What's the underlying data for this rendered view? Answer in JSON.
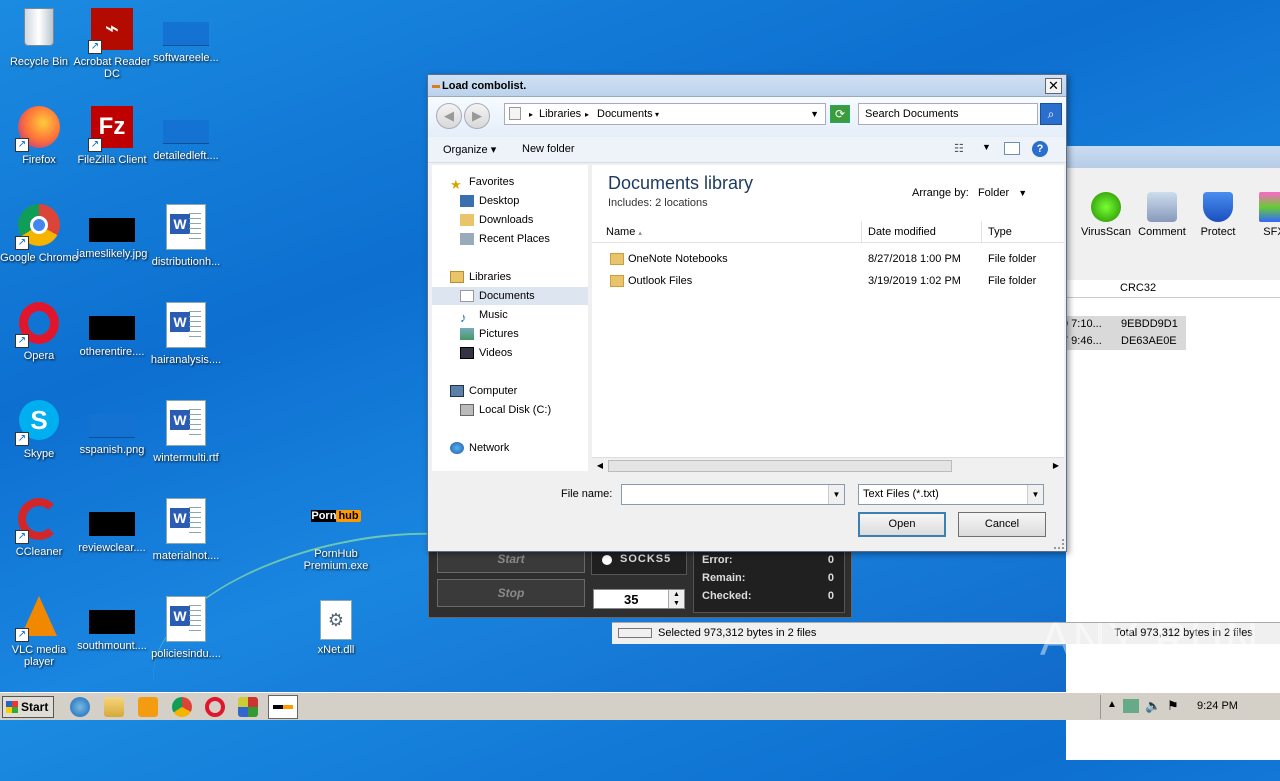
{
  "desktop": {
    "icons": [
      {
        "label": "Recycle Bin"
      },
      {
        "label": "Acrobat Reader DC"
      },
      {
        "label": "softwareele..."
      },
      {
        "label": "Firefox"
      },
      {
        "label": "FileZilla Client"
      },
      {
        "label": "detailedleft...."
      },
      {
        "label": "Google Chrome"
      },
      {
        "label": "jameslikely.jpg"
      },
      {
        "label": "distributionh..."
      },
      {
        "label": "Opera"
      },
      {
        "label": "otherentire...."
      },
      {
        "label": "hairanalysis...."
      },
      {
        "label": "Skype"
      },
      {
        "label": "sspanish.png"
      },
      {
        "label": "wintermulti.rtf"
      },
      {
        "label": "CCleaner"
      },
      {
        "label": "reviewclear...."
      },
      {
        "label": "materialnot...."
      },
      {
        "label": "PornHub Premium.exe"
      },
      {
        "label": "VLC media player"
      },
      {
        "label": "southmount...."
      },
      {
        "label": "policiesindu...."
      },
      {
        "label": "xNet.dll"
      }
    ],
    "logo_text": {
      "part1": "Porn",
      "part2": "hub"
    }
  },
  "background_app": {
    "tools": [
      "VirusScan",
      "Comment",
      "Protect",
      "SFX"
    ],
    "column_header": "CRC32",
    "rows": [
      {
        "date": "9 7:10...",
        "crc": "9EBDD9D1"
      },
      {
        "date": "7 9:46...",
        "crc": "DE63AE0E"
      }
    ],
    "status_left": "Selected 973,312 bytes in 2 files",
    "status_right": "Total 973,312 bytes in 2 files"
  },
  "combolist_app": {
    "start_label": "Start",
    "stop_label": "Stop",
    "proxy_option": "SOCKS5",
    "threads_value": "35",
    "stats": [
      {
        "label": "Error:",
        "value": "0"
      },
      {
        "label": "Remain:",
        "value": "0"
      },
      {
        "label": "Checked:",
        "value": "0"
      }
    ]
  },
  "dialog": {
    "title": "Load combolist.",
    "close_label": "✕",
    "breadcrumb": [
      "Libraries",
      "Documents"
    ],
    "search_placeholder": "Search Documents",
    "organize_label": "Organize",
    "new_folder_label": "New folder",
    "nav": {
      "favorites_label": "Favorites",
      "favorites": [
        "Desktop",
        "Downloads",
        "Recent Places"
      ],
      "libraries_label": "Libraries",
      "libraries": [
        "Documents",
        "Music",
        "Pictures",
        "Videos"
      ],
      "computer_label": "Computer",
      "computer": [
        "Local Disk (C:)"
      ],
      "network_label": "Network"
    },
    "library_title": "Documents library",
    "library_includes": "Includes:  2 locations",
    "arrange_label": "Arrange by:",
    "arrange_value": "Folder",
    "columns": [
      "Name",
      "Date modified",
      "Type"
    ],
    "files": [
      {
        "name": "OneNote Notebooks",
        "date": "8/27/2018 1:00 PM",
        "type": "File folder"
      },
      {
        "name": "Outlook Files",
        "date": "3/19/2019 1:02 PM",
        "type": "File folder"
      }
    ],
    "file_name_label": "File name:",
    "file_name_value": "",
    "file_type_value": "Text Files (*.txt)",
    "open_label": "Open",
    "cancel_label": "Cancel"
  },
  "taskbar": {
    "start_label": "Start",
    "clock": "9:24 PM"
  },
  "watermark": "ANY RUN"
}
